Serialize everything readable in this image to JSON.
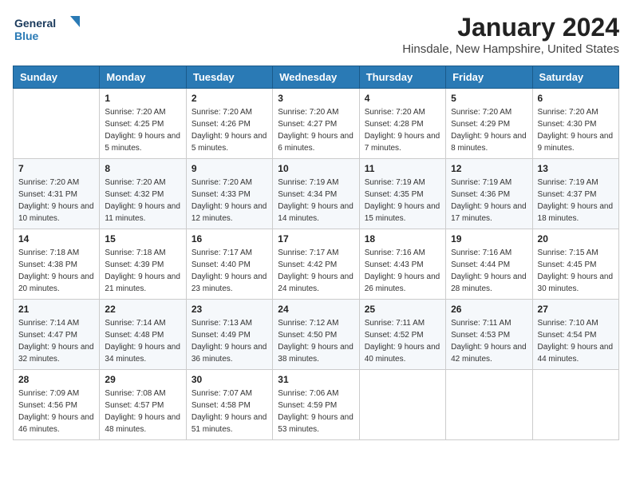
{
  "logo": {
    "line1": "General",
    "line2": "Blue"
  },
  "header": {
    "month": "January 2024",
    "location": "Hinsdale, New Hampshire, United States"
  },
  "weekdays": [
    "Sunday",
    "Monday",
    "Tuesday",
    "Wednesday",
    "Thursday",
    "Friday",
    "Saturday"
  ],
  "weeks": [
    [
      {
        "day": "",
        "sunrise": "",
        "sunset": "",
        "daylight": ""
      },
      {
        "day": "1",
        "sunrise": "Sunrise: 7:20 AM",
        "sunset": "Sunset: 4:25 PM",
        "daylight": "Daylight: 9 hours and 5 minutes."
      },
      {
        "day": "2",
        "sunrise": "Sunrise: 7:20 AM",
        "sunset": "Sunset: 4:26 PM",
        "daylight": "Daylight: 9 hours and 5 minutes."
      },
      {
        "day": "3",
        "sunrise": "Sunrise: 7:20 AM",
        "sunset": "Sunset: 4:27 PM",
        "daylight": "Daylight: 9 hours and 6 minutes."
      },
      {
        "day": "4",
        "sunrise": "Sunrise: 7:20 AM",
        "sunset": "Sunset: 4:28 PM",
        "daylight": "Daylight: 9 hours and 7 minutes."
      },
      {
        "day": "5",
        "sunrise": "Sunrise: 7:20 AM",
        "sunset": "Sunset: 4:29 PM",
        "daylight": "Daylight: 9 hours and 8 minutes."
      },
      {
        "day": "6",
        "sunrise": "Sunrise: 7:20 AM",
        "sunset": "Sunset: 4:30 PM",
        "daylight": "Daylight: 9 hours and 9 minutes."
      }
    ],
    [
      {
        "day": "7",
        "sunrise": "Sunrise: 7:20 AM",
        "sunset": "Sunset: 4:31 PM",
        "daylight": "Daylight: 9 hours and 10 minutes."
      },
      {
        "day": "8",
        "sunrise": "Sunrise: 7:20 AM",
        "sunset": "Sunset: 4:32 PM",
        "daylight": "Daylight: 9 hours and 11 minutes."
      },
      {
        "day": "9",
        "sunrise": "Sunrise: 7:20 AM",
        "sunset": "Sunset: 4:33 PM",
        "daylight": "Daylight: 9 hours and 12 minutes."
      },
      {
        "day": "10",
        "sunrise": "Sunrise: 7:19 AM",
        "sunset": "Sunset: 4:34 PM",
        "daylight": "Daylight: 9 hours and 14 minutes."
      },
      {
        "day": "11",
        "sunrise": "Sunrise: 7:19 AM",
        "sunset": "Sunset: 4:35 PM",
        "daylight": "Daylight: 9 hours and 15 minutes."
      },
      {
        "day": "12",
        "sunrise": "Sunrise: 7:19 AM",
        "sunset": "Sunset: 4:36 PM",
        "daylight": "Daylight: 9 hours and 17 minutes."
      },
      {
        "day": "13",
        "sunrise": "Sunrise: 7:19 AM",
        "sunset": "Sunset: 4:37 PM",
        "daylight": "Daylight: 9 hours and 18 minutes."
      }
    ],
    [
      {
        "day": "14",
        "sunrise": "Sunrise: 7:18 AM",
        "sunset": "Sunset: 4:38 PM",
        "daylight": "Daylight: 9 hours and 20 minutes."
      },
      {
        "day": "15",
        "sunrise": "Sunrise: 7:18 AM",
        "sunset": "Sunset: 4:39 PM",
        "daylight": "Daylight: 9 hours and 21 minutes."
      },
      {
        "day": "16",
        "sunrise": "Sunrise: 7:17 AM",
        "sunset": "Sunset: 4:40 PM",
        "daylight": "Daylight: 9 hours and 23 minutes."
      },
      {
        "day": "17",
        "sunrise": "Sunrise: 7:17 AM",
        "sunset": "Sunset: 4:42 PM",
        "daylight": "Daylight: 9 hours and 24 minutes."
      },
      {
        "day": "18",
        "sunrise": "Sunrise: 7:16 AM",
        "sunset": "Sunset: 4:43 PM",
        "daylight": "Daylight: 9 hours and 26 minutes."
      },
      {
        "day": "19",
        "sunrise": "Sunrise: 7:16 AM",
        "sunset": "Sunset: 4:44 PM",
        "daylight": "Daylight: 9 hours and 28 minutes."
      },
      {
        "day": "20",
        "sunrise": "Sunrise: 7:15 AM",
        "sunset": "Sunset: 4:45 PM",
        "daylight": "Daylight: 9 hours and 30 minutes."
      }
    ],
    [
      {
        "day": "21",
        "sunrise": "Sunrise: 7:14 AM",
        "sunset": "Sunset: 4:47 PM",
        "daylight": "Daylight: 9 hours and 32 minutes."
      },
      {
        "day": "22",
        "sunrise": "Sunrise: 7:14 AM",
        "sunset": "Sunset: 4:48 PM",
        "daylight": "Daylight: 9 hours and 34 minutes."
      },
      {
        "day": "23",
        "sunrise": "Sunrise: 7:13 AM",
        "sunset": "Sunset: 4:49 PM",
        "daylight": "Daylight: 9 hours and 36 minutes."
      },
      {
        "day": "24",
        "sunrise": "Sunrise: 7:12 AM",
        "sunset": "Sunset: 4:50 PM",
        "daylight": "Daylight: 9 hours and 38 minutes."
      },
      {
        "day": "25",
        "sunrise": "Sunrise: 7:11 AM",
        "sunset": "Sunset: 4:52 PM",
        "daylight": "Daylight: 9 hours and 40 minutes."
      },
      {
        "day": "26",
        "sunrise": "Sunrise: 7:11 AM",
        "sunset": "Sunset: 4:53 PM",
        "daylight": "Daylight: 9 hours and 42 minutes."
      },
      {
        "day": "27",
        "sunrise": "Sunrise: 7:10 AM",
        "sunset": "Sunset: 4:54 PM",
        "daylight": "Daylight: 9 hours and 44 minutes."
      }
    ],
    [
      {
        "day": "28",
        "sunrise": "Sunrise: 7:09 AM",
        "sunset": "Sunset: 4:56 PM",
        "daylight": "Daylight: 9 hours and 46 minutes."
      },
      {
        "day": "29",
        "sunrise": "Sunrise: 7:08 AM",
        "sunset": "Sunset: 4:57 PM",
        "daylight": "Daylight: 9 hours and 48 minutes."
      },
      {
        "day": "30",
        "sunrise": "Sunrise: 7:07 AM",
        "sunset": "Sunset: 4:58 PM",
        "daylight": "Daylight: 9 hours and 51 minutes."
      },
      {
        "day": "31",
        "sunrise": "Sunrise: 7:06 AM",
        "sunset": "Sunset: 4:59 PM",
        "daylight": "Daylight: 9 hours and 53 minutes."
      },
      {
        "day": "",
        "sunrise": "",
        "sunset": "",
        "daylight": ""
      },
      {
        "day": "",
        "sunrise": "",
        "sunset": "",
        "daylight": ""
      },
      {
        "day": "",
        "sunrise": "",
        "sunset": "",
        "daylight": ""
      }
    ]
  ]
}
